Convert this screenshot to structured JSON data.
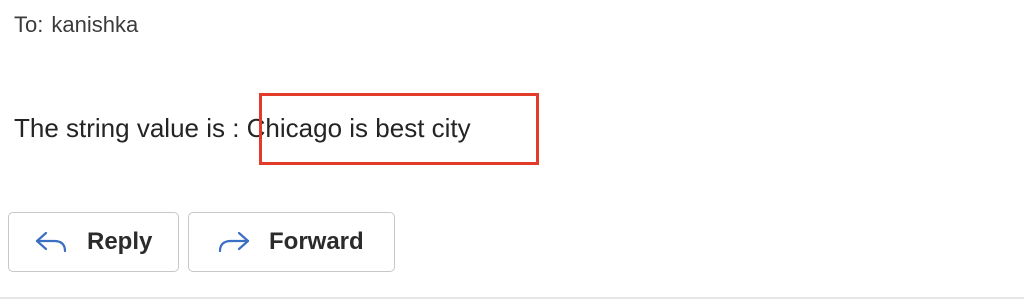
{
  "header": {
    "to_label": "To:",
    "recipient": "kanishka"
  },
  "message": {
    "prefix": "The string value is : ",
    "value": "Chicago is best city"
  },
  "actions": {
    "reply_label": "Reply",
    "forward_label": "Forward",
    "reply_icon": "reply-arrow-icon",
    "forward_icon": "forward-arrow-icon"
  },
  "colors": {
    "highlight_border": "#e23b2a",
    "icon_blue": "#3b6fc4"
  }
}
